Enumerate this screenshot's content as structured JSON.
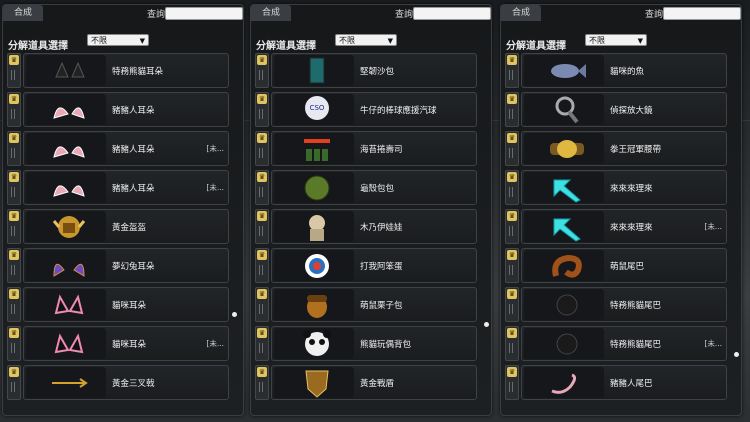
{
  "panels": [
    {
      "tab": "合成",
      "search_label": "查詢",
      "filter_label": "分解道具選擇",
      "filter_value": "不限",
      "items": [
        {
          "name": "特務熊貓耳朵",
          "tag": "",
          "icon": "black-cat-ears-icon"
        },
        {
          "name": "豬豬人耳朵",
          "tag": "",
          "icon": "pink-ears-icon"
        },
        {
          "name": "豬豬人耳朵",
          "tag": "[未...",
          "icon": "pink-ears-icon"
        },
        {
          "name": "豬豬人耳朵",
          "tag": "[未...",
          "icon": "pink-ears-icon"
        },
        {
          "name": "黃金盔盔",
          "tag": "",
          "icon": "golden-helmet-icon"
        },
        {
          "name": "夢幻兔耳朵",
          "tag": "",
          "icon": "purple-ears-icon"
        },
        {
          "name": "貓咪耳朵",
          "tag": "",
          "icon": "cat-ears-icon"
        },
        {
          "name": "貓咪耳朵",
          "tag": "[未...",
          "icon": "cat-ears-icon"
        },
        {
          "name": "黃金三叉戟",
          "tag": "",
          "icon": "golden-trident-icon"
        }
      ]
    },
    {
      "tab": "合成",
      "search_label": "查詢",
      "filter_label": "分解道具選擇",
      "filter_value": "不限",
      "items": [
        {
          "name": "堅韌沙包",
          "tag": "",
          "icon": "sandbag-icon"
        },
        {
          "name": "牛仔的棒球應援汽球",
          "tag": "",
          "icon": "balloon-icon"
        },
        {
          "name": "海苔捲壽司",
          "tag": "",
          "icon": "sushi-icon"
        },
        {
          "name": "龜殼包包",
          "tag": "",
          "icon": "turtle-shell-icon"
        },
        {
          "name": "木乃伊娃娃",
          "tag": "",
          "icon": "mummy-doll-icon"
        },
        {
          "name": "打我阿笨蛋",
          "tag": "",
          "icon": "target-icon"
        },
        {
          "name": "萌鼠栗子包",
          "tag": "",
          "icon": "acorn-icon"
        },
        {
          "name": "熊貓玩偶背包",
          "tag": "",
          "icon": "panda-icon"
        },
        {
          "name": "黃金戰盾",
          "tag": "",
          "icon": "golden-shield-icon"
        }
      ]
    },
    {
      "tab": "合成",
      "search_label": "查詢",
      "filter_label": "分解道具選擇",
      "filter_value": "不限",
      "items": [
        {
          "name": "貓咪的魚",
          "tag": "",
          "icon": "fish-icon"
        },
        {
          "name": "偵探放大鏡",
          "tag": "",
          "icon": "magnifier-icon"
        },
        {
          "name": "拳王冠軍腰帶",
          "tag": "",
          "icon": "champion-belt-icon"
        },
        {
          "name": "來來來理來",
          "tag": "",
          "icon": "cyan-arrow-icon"
        },
        {
          "name": "來來來理來",
          "tag": "[未...",
          "icon": "cyan-arrow-icon"
        },
        {
          "name": "萌鼠尾巴",
          "tag": "",
          "icon": "brown-tail-icon"
        },
        {
          "name": "特務熊貓尾巴",
          "tag": "",
          "icon": "black-tail-icon"
        },
        {
          "name": "特務熊貓尾巴",
          "tag": "[未...",
          "icon": "black-tail-icon"
        },
        {
          "name": "豬豬人尾巴",
          "tag": "",
          "icon": "pink-tail-icon"
        }
      ]
    }
  ],
  "lock_glyph": "♛"
}
